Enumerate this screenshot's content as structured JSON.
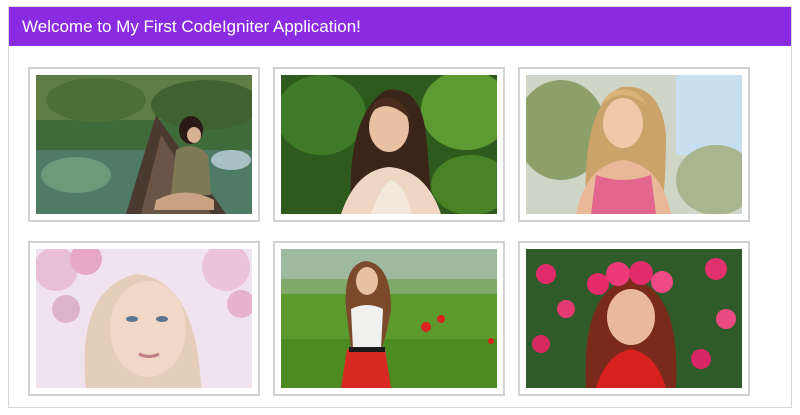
{
  "header": {
    "title": "Welcome to My First CodeIgniter Application!"
  },
  "colors": {
    "header_bg": "#8a2be2",
    "header_text": "#ffffff",
    "thumb_border": "#d2d2d2"
  },
  "gallery": {
    "items": [
      {
        "name": "photo-woman-on-boat"
      },
      {
        "name": "photo-woman-brown-hair-forest"
      },
      {
        "name": "photo-woman-blonde-pink-top"
      },
      {
        "name": "photo-woman-cherry-blossom"
      },
      {
        "name": "photo-girl-poppy-field"
      },
      {
        "name": "photo-girl-flower-crown"
      }
    ]
  }
}
